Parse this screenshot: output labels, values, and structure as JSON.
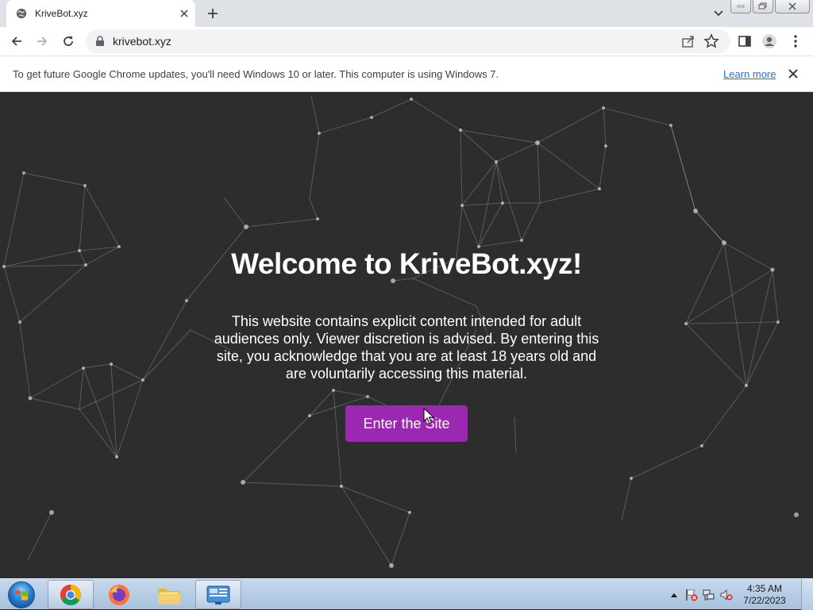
{
  "tab": {
    "title": "KriveBot.xyz"
  },
  "omnibox": {
    "url": "krivebot.xyz"
  },
  "infobar": {
    "message": "To get future Google Chrome updates, you'll need Windows 10 or later. This computer is using Windows 7.",
    "link": "Learn more"
  },
  "page": {
    "title": "Welcome to KriveBot.xyz!",
    "warning": "This website contains explicit content intended for adult audiences only. Viewer discretion is advised. By entering this site, you acknowledge that you are at least 18 years old and are voluntarily accessing this material.",
    "enter_button": "Enter the Site",
    "button_color": "#9c27b0",
    "background_color": "#2d2d2d"
  },
  "taskbar": {
    "apps": [
      "chrome-icon",
      "firefox-icon",
      "file-explorer-icon",
      "control-panel-icon"
    ],
    "clock": {
      "time": "4:35 AM",
      "date": "7/22/2023"
    }
  }
}
